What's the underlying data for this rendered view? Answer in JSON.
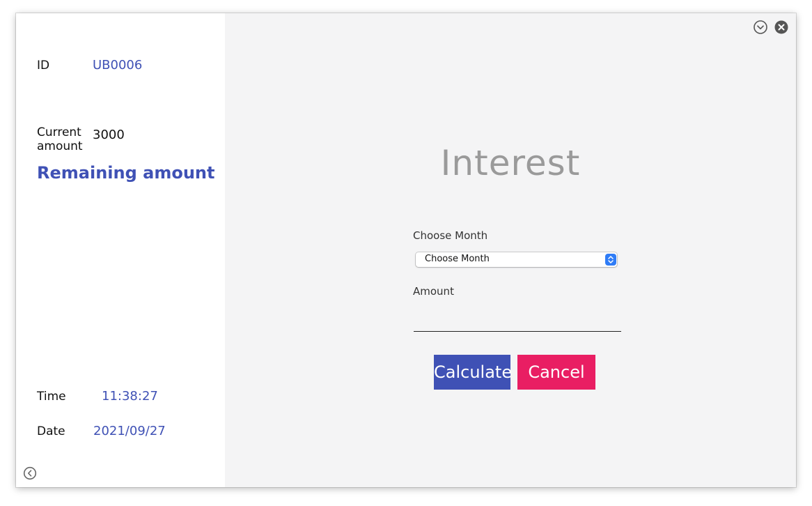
{
  "sidebar": {
    "id_label": "ID",
    "id_value": "UB0006",
    "current_amount_label": "Current amount",
    "current_amount_value": "3000",
    "remaining_amount_title": "Remaining amount",
    "time_label": "Time",
    "time_value": "11:38:27",
    "date_label": "Date",
    "date_value": "2021/09/27",
    "back_icon": "chevron-left-circle-icon"
  },
  "window_controls": {
    "minimize_icon": "chevron-down-circle-icon",
    "close_icon": "close-circle-icon"
  },
  "main": {
    "heading": "Interest",
    "month_label": "Choose Month",
    "month_select_value": "Choose Month",
    "amount_label": "Amount",
    "amount_value": "",
    "calculate_label": "Calculate",
    "cancel_label": "Cancel"
  },
  "colors": {
    "accent": "#3f51b5",
    "cancel": "#e91e63",
    "heading_gray": "#9a9a9a",
    "panel_bg": "#f4f4f5"
  }
}
